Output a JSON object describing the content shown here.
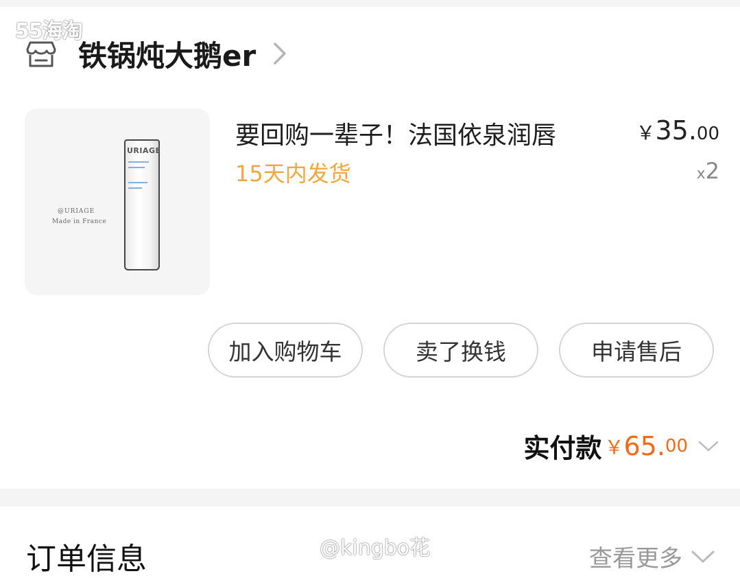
{
  "watermark_top": "55海淘",
  "shop": {
    "name": "铁锅炖大鹅er"
  },
  "product": {
    "image": {
      "brand": "@URIAGE",
      "made_in": "Made in France",
      "tube_label": "URIAGE"
    },
    "title": "要回购一辈子！法国依泉润唇",
    "shipping": "15天内发货",
    "price": {
      "currency": "￥",
      "integer": "35.",
      "decimal": "00"
    },
    "quantity": {
      "prefix": "x",
      "value": "2"
    }
  },
  "actions": [
    "加入购物车",
    "卖了换钱",
    "申请售后"
  ],
  "payment": {
    "label": "实付款",
    "currency": "￥",
    "integer": "65.",
    "decimal": "00"
  },
  "order_info": {
    "title": "订单信息",
    "more": "查看更多"
  },
  "watermark_bottom": "@kingbo花",
  "colors": {
    "shipping": "#f2a73d",
    "paid_amount": "#f26a16",
    "divider": "#f4f4f4"
  },
  "icons": [
    "shop-icon",
    "chevron-right-icon",
    "chevron-down-icon"
  ]
}
